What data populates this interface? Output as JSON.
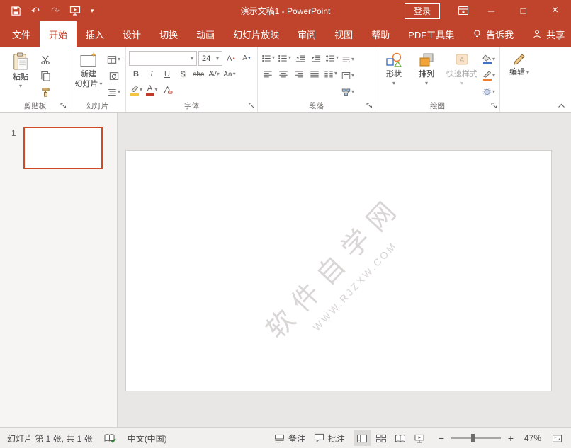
{
  "colors": {
    "titlebar": "#C0432B",
    "active_tab_text": "#C0432B",
    "thumbnail_border": "#D04A26",
    "canvas_bg": "#E9E7E6"
  },
  "icons": {
    "dropdown": "▾",
    "triangle_up": "▴",
    "undo": "↶",
    "redo": "↷",
    "minimize": "─",
    "maximize": "□",
    "close": "×",
    "zoom_out": "−",
    "zoom_in": "+"
  },
  "titlebar": {
    "title": "演示文稿1 - PowerPoint",
    "login": "登录"
  },
  "tabs": {
    "file": "文件",
    "items": [
      "开始",
      "插入",
      "设计",
      "切换",
      "动画",
      "幻灯片放映",
      "审阅",
      "视图",
      "帮助",
      "PDF工具集"
    ],
    "tellme": "告诉我",
    "share": "共享"
  },
  "ribbon": {
    "groups": [
      "剪贴板",
      "幻灯片",
      "字体",
      "段落",
      "绘图"
    ],
    "clipboard": {
      "paste": "粘贴"
    },
    "slides": {
      "new_slide_line1": "新建",
      "new_slide_line2": "幻灯片"
    },
    "font": {
      "name": "",
      "size": "24",
      "bold": "B",
      "italic": "I",
      "underline": "U",
      "shadow": "S",
      "strike": "abc",
      "spacing": "AV",
      "case": "Aa",
      "color": "A",
      "grow": "A",
      "shrink": "A"
    },
    "drawing": {
      "shapes": "形状",
      "arrange": "排列",
      "quick_styles": "快速样式"
    },
    "editing": {
      "edit": "编辑"
    }
  },
  "slides_panel": {
    "slide_number": "1"
  },
  "slide": {
    "watermark_line1": "软件自学网",
    "watermark_line2": "WWW.RJZXW.COM"
  },
  "statusbar": {
    "slide_info": "幻灯片 第 1 张, 共 1 张",
    "language": "中文(中国)",
    "notes": "备注",
    "comments": "批注",
    "zoom": "47%"
  }
}
